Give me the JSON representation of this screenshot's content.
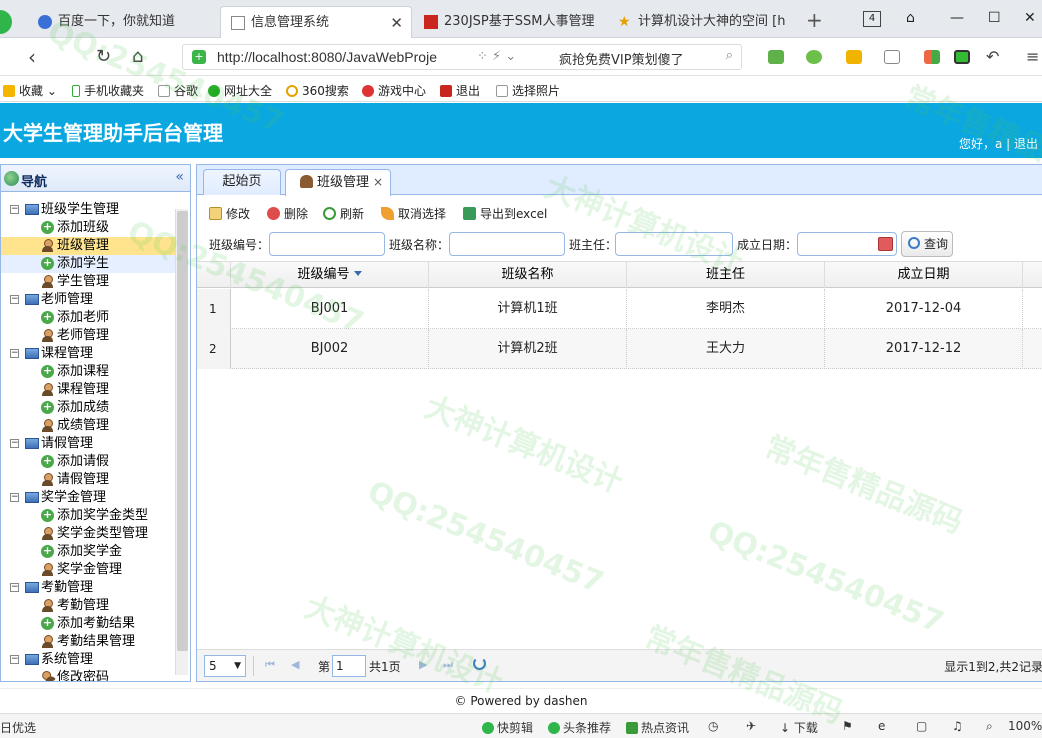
{
  "browser": {
    "tabs": [
      {
        "title": "百度一下，你就知道",
        "active": false
      },
      {
        "title": "信息管理系统",
        "active": true
      },
      {
        "title": "230JSP基于SSM人事管理",
        "active": false
      },
      {
        "title": "计算机设计大神的空间 [h",
        "active": false
      }
    ],
    "tab_count": "4",
    "url": "http://localhost:8080/JavaWebProje",
    "promo": "疯抢免费VIP策划傻了",
    "bookmarks": [
      "收藏",
      "手机收藏夹",
      "谷歌",
      "网址大全",
      "360搜索",
      "游戏中心",
      "退出",
      "选择照片"
    ]
  },
  "app": {
    "title": "大学生管理助手后台管理",
    "greeting": "您好，a | 退出"
  },
  "sidebar": {
    "title": "导航",
    "groups": [
      {
        "label": "班级学生管理",
        "items": [
          "添加班级",
          "班级管理",
          "添加学生",
          "学生管理"
        ]
      },
      {
        "label": "老师管理",
        "items": [
          "添加老师",
          "老师管理"
        ]
      },
      {
        "label": "课程管理",
        "items": [
          "添加课程",
          "课程管理",
          "添加成绩",
          "成绩管理"
        ]
      },
      {
        "label": "请假管理",
        "items": [
          "添加请假",
          "请假管理"
        ]
      },
      {
        "label": "奖学金管理",
        "items": [
          "添加奖学金类型",
          "奖学金类型管理",
          "添加奖学金",
          "奖学金管理"
        ]
      },
      {
        "label": "考勤管理",
        "items": [
          "考勤管理",
          "添加考勤结果",
          "考勤结果管理"
        ]
      },
      {
        "label": "系统管理",
        "items": [
          "修改密码"
        ]
      }
    ]
  },
  "main": {
    "tabs": [
      {
        "label": "起始页"
      },
      {
        "label": "班级管理",
        "close": "×"
      }
    ],
    "toolbar": [
      "修改",
      "删除",
      "刷新",
      "取消选择",
      "导出到excel"
    ],
    "search": {
      "class_no_label": "班级编号：",
      "class_name_label": "班级名称：",
      "teacher_label": "班主任：",
      "date_label": "成立日期：",
      "query_label": "查询"
    },
    "grid": {
      "columns": [
        "班级编号",
        "班级名称",
        "班主任",
        "成立日期"
      ],
      "rows": [
        {
          "num": "1",
          "cells": [
            "BJ001",
            "计算机1班",
            "李明杰",
            "2017-12-04"
          ]
        },
        {
          "num": "2",
          "cells": [
            "BJ002",
            "计算机2班",
            "王大力",
            "2017-12-12"
          ]
        }
      ]
    },
    "pager": {
      "page_size": "5",
      "page_prefix": "第",
      "page_value": "1",
      "page_total": "共1页",
      "info": "显示1到2,共2记录"
    }
  },
  "footer": "© Powered by dashen",
  "statusbar": [
    "日优选",
    "快剪辑",
    "头条推荐",
    "热点资讯",
    "下载",
    "100%"
  ],
  "watermarks": [
    "QQ:254540457",
    "大神计算机设计",
    "常年售精品源码"
  ]
}
